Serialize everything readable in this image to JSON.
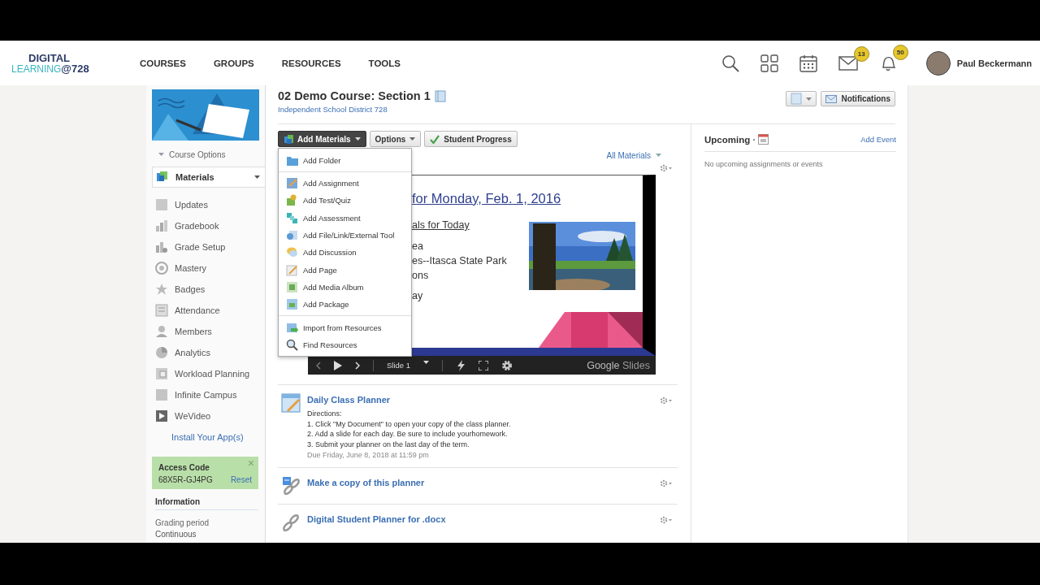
{
  "brand": {
    "line1": "DIGITAL",
    "line2": "LEARNING",
    "line3": "@728"
  },
  "nav": [
    {
      "label": "COURSES"
    },
    {
      "label": "GROUPS"
    },
    {
      "label": "RESOURCES"
    },
    {
      "label": "TOOLS"
    }
  ],
  "header": {
    "mail_count": "13",
    "alert_count": "50",
    "user": "Paul Beckermann"
  },
  "course": {
    "title": "02 Demo Course: Section 1",
    "school": "Independent School District 728",
    "notifications": "Notifications"
  },
  "sidebar": {
    "course_options": "Course Options",
    "items": [
      {
        "label": "Materials",
        "selected": true
      },
      {
        "label": "Updates",
        "selected": false
      },
      {
        "label": "Gradebook",
        "selected": false
      },
      {
        "label": "Grade Setup",
        "selected": false
      },
      {
        "label": "Mastery",
        "selected": false
      },
      {
        "label": "Badges",
        "selected": false
      },
      {
        "label": "Attendance",
        "selected": false
      },
      {
        "label": "Members",
        "selected": false
      },
      {
        "label": "Analytics",
        "selected": false
      },
      {
        "label": "Workload Planning",
        "selected": false
      },
      {
        "label": "Infinite Campus",
        "selected": false
      },
      {
        "label": "WeVideo",
        "selected": false
      }
    ],
    "install": "Install Your App(s)",
    "access": {
      "label": "Access Code",
      "code": "68X5R-GJ4PG",
      "reset": "Reset"
    },
    "info": {
      "heading": "Information",
      "label": "Grading period",
      "value": "Continuous"
    }
  },
  "toolbar": [
    {
      "label": "Add Materials",
      "kind": "menu",
      "expanded": true
    },
    {
      "label": "Options",
      "kind": "menu",
      "expanded": false
    },
    {
      "label": "Student Progress",
      "kind": "check"
    }
  ],
  "filter": "All Materials",
  "menu": {
    "groups": [
      [
        {
          "label": "Add Folder"
        }
      ],
      [
        {
          "label": "Add Assignment"
        },
        {
          "label": "Add Test/Quiz"
        },
        {
          "label": "Add Assessment"
        },
        {
          "label": "Add File/Link/External Tool"
        },
        {
          "label": "Add Discussion"
        },
        {
          "label": "Add Page"
        },
        {
          "label": "Add Media Album"
        },
        {
          "label": "Add Package"
        }
      ],
      [
        {
          "label": "Import from Resources"
        },
        {
          "label": "Find Resources"
        }
      ]
    ]
  },
  "slide": {
    "title": "for Monday, Feb. 1, 2016",
    "subtitle": "als for Today",
    "lines": [
      "ea",
      "es--Itasca State Park",
      "ons"
    ],
    "last": "ay",
    "page": "Slide 1",
    "brand_a": "Google",
    "brand_b": "Slides"
  },
  "materials": [
    {
      "kind": "assignment",
      "title": "Daily Class Planner",
      "lines": [
        "Directions:",
        "1. Click \"My Document\" to open your copy of the class planner.",
        "2. Add a slide for each day. Be sure to include yourhomework.",
        "3. Submit your planner on the last day of the term."
      ],
      "due": "Due Friday, June 8, 2018 at 11:59 pm"
    },
    {
      "kind": "doc-link",
      "title": "Make a copy of this planner"
    },
    {
      "kind": "link",
      "title": "Digital Student Planner for .docx"
    }
  ],
  "upcoming": {
    "title": "Upcoming",
    "add": "Add Event",
    "empty": "No upcoming assignments or events"
  }
}
